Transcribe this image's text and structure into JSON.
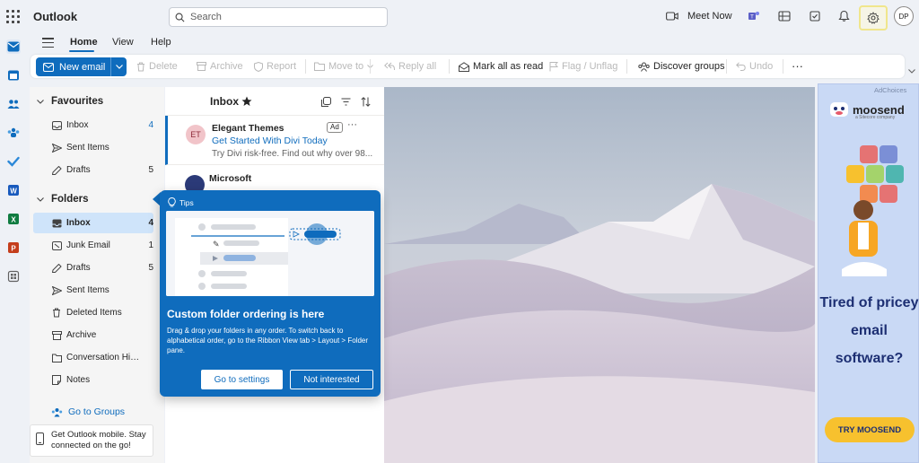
{
  "app": {
    "title": "Outlook"
  },
  "search": {
    "placeholder": "Search"
  },
  "topbar": {
    "meet_now": "Meet Now",
    "avatar_initials": "DP"
  },
  "ribbon": {
    "tabs": [
      "Home",
      "View",
      "Help"
    ]
  },
  "toolbar": {
    "new_email": "New email",
    "delete": "Delete",
    "archive": "Archive",
    "report": "Report",
    "move_to": "Move to",
    "reply_all": "Reply all",
    "mark_all_read": "Mark all as read",
    "flag": "Flag / Unflag",
    "discover_groups": "Discover groups",
    "undo": "Undo",
    "more": "···"
  },
  "favourites": {
    "title": "Favourites",
    "items": [
      {
        "label": "Inbox",
        "count": "4"
      },
      {
        "label": "Sent Items",
        "count": ""
      },
      {
        "label": "Drafts",
        "count": "5"
      }
    ]
  },
  "folders": {
    "title": "Folders",
    "items": [
      {
        "label": "Inbox",
        "count": "4"
      },
      {
        "label": "Junk Email",
        "count": "1"
      },
      {
        "label": "Drafts",
        "count": "5"
      },
      {
        "label": "Sent Items",
        "count": ""
      },
      {
        "label": "Deleted Items",
        "count": ""
      },
      {
        "label": "Archive",
        "count": ""
      },
      {
        "label": "Conversation History",
        "count": ""
      },
      {
        "label": "Notes",
        "count": ""
      }
    ]
  },
  "groups": {
    "link": "Go to Groups"
  },
  "mobile": {
    "text": "Get Outlook mobile. Stay connected on the go!"
  },
  "message_list": {
    "title": "Inbox",
    "messages": [
      {
        "avatar": "ET",
        "sender": "Elegant Themes",
        "subject": "Get Started With Divi Today",
        "preview": "Try Divi risk-free. Find out why over 98...",
        "badge": "Ad"
      },
      {
        "sender": "Microsoft"
      }
    ]
  },
  "tips": {
    "label": "Tips",
    "title": "Custom folder ordering is here",
    "body": "Drag & drop your folders in any order. To switch back to alphabetical order, go to the Ribbon View tab > Layout > Folder pane.",
    "primary": "Go to settings",
    "secondary": "Not interested"
  },
  "ad": {
    "adchoices": "AdChoices",
    "brand": "moosend",
    "tagline": "a Sitecore company",
    "headline": "Tired of pricey email software?",
    "cta": "TRY MOOSEND"
  },
  "colors": {
    "accent": "#0f6cbd",
    "selected": "#cfe4fa",
    "ad_cta": "#f7c12e",
    "ad_bg": "#c9d9f5"
  }
}
